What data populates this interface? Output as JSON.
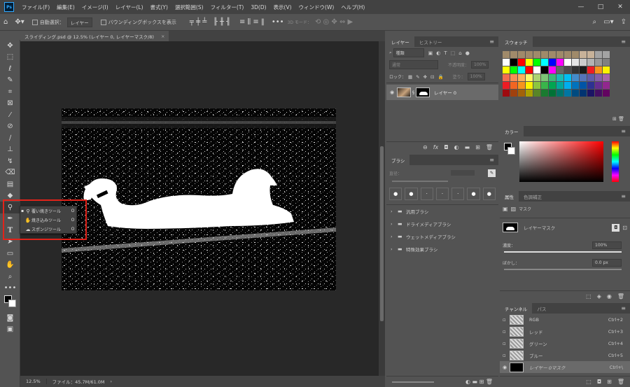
{
  "app": {
    "logo_text": "Ps"
  },
  "menu": [
    "ファイル(F)",
    "編集(E)",
    "イメージ(I)",
    "レイヤー(L)",
    "書式(Y)",
    "選択範囲(S)",
    "フィルター(T)",
    "3D(D)",
    "表示(V)",
    "ウィンドウ(W)",
    "ヘルプ(H)"
  ],
  "window_controls": [
    "—",
    "□",
    "✕"
  ],
  "options": {
    "auto_select_label": "自動選択：",
    "auto_select_value": "レイヤー",
    "bbox_label": "バウンディングボックスを表示",
    "mode_label": "3D モード："
  },
  "document": {
    "tab_title": "スライディング.psd @ 12.5% (レイヤー 0, レイヤーマスク/8)",
    "tab_close": "×",
    "zoom": "12.5%",
    "file_info": "ファイル：45.7M/61.0M"
  },
  "flyout": [
    {
      "label": "覆い焼きツール",
      "key": "O",
      "selected": true
    },
    {
      "label": "焼き込みツール",
      "key": "O",
      "selected": false
    },
    {
      "label": "スポンジツール",
      "key": "O",
      "selected": false
    }
  ],
  "layers_panel": {
    "tabs": [
      "レイヤー",
      "ヒストリー"
    ],
    "filter_kind": "種類",
    "blend_mode": "通常",
    "opacity_label": "不透明度：",
    "opacity_value": "100%",
    "lock_label": "ロック：",
    "fill_label": "塗り：",
    "fill_value": "100%",
    "layer_name": "レイヤー 0"
  },
  "brush_panel": {
    "tab": "ブラシ",
    "size_label": "直径：",
    "folders": [
      "汎用ブラシ",
      "ドライメディアブラシ",
      "ウェットメディアブラシ",
      "特殊効果ブラシ"
    ]
  },
  "swatches_panel": {
    "tab": "スウォッチ",
    "rows": [
      [
        "#a08a6a",
        "#a08a6a",
        "#a08a6a",
        "#a08a6a",
        "#a08a6a",
        "#a08a6a",
        "#a08a6a",
        "#a08a6a",
        "#a08a6a",
        "#a08a6a",
        "#c7b299",
        "#c7b299",
        "#a3a3a3",
        "#a3a3a3"
      ],
      [
        "#ffffff",
        "#000000",
        "#ff0000",
        "#ffff00",
        "#00ff00",
        "#00ffff",
        "#0000ff",
        "#ff00ff",
        "#ffffff",
        "#e6e6e6",
        "#cccccc",
        "#b3b3b3",
        "#999999",
        "#808080"
      ],
      [
        "#ffff00",
        "#00ff00",
        "#00ffff",
        "#ff0000",
        "#ffffff",
        "#000000",
        "#ff00ff",
        "#666666",
        "#4d4d4d",
        "#333333",
        "#1a1a1a",
        "#ed1c24",
        "#f7941d",
        "#fff200"
      ],
      [
        "#f26c4f",
        "#f68e56",
        "#fbaf5c",
        "#fff467",
        "#acd372",
        "#7cc576",
        "#3bb878",
        "#1abbb4",
        "#00bff3",
        "#438ccb",
        "#5574b9",
        "#605ca9",
        "#855fa8",
        "#a763a9"
      ],
      [
        "#ed1c24",
        "#f26522",
        "#f7941d",
        "#fff200",
        "#8dc63f",
        "#39b54a",
        "#00a651",
        "#00a99d",
        "#00aeef",
        "#0072bc",
        "#0054a6",
        "#2e3192",
        "#662d91",
        "#92278f"
      ],
      [
        "#9e0b0f",
        "#a0410d",
        "#a36209",
        "#aba000",
        "#598527",
        "#1a7b30",
        "#007236",
        "#00746b",
        "#0076a3",
        "#004b80",
        "#003471",
        "#1b1464",
        "#440e62",
        "#630460"
      ]
    ]
  },
  "color_panel": {
    "tab": "カラー"
  },
  "properties_panel": {
    "tabs": [
      "属性",
      "色調補正"
    ],
    "mask_label": "マスク",
    "layer_mask_label": "レイヤーマスク",
    "density_label": "濃度：",
    "density_value": "100%",
    "feather_label": "ぼかし：",
    "feather_value": "0.0 px"
  },
  "channels_panel": {
    "tabs": [
      "チャンネル",
      "パス"
    ],
    "rows": [
      {
        "name": "RGB",
        "shortcut": "Ctrl+2"
      },
      {
        "name": "レッド",
        "shortcut": "Ctrl+3"
      },
      {
        "name": "グリーン",
        "shortcut": "Ctrl+4"
      },
      {
        "name": "ブルー",
        "shortcut": "Ctrl+5"
      },
      {
        "name": "レイヤー 0マスク",
        "shortcut": "Ctrl+\\"
      }
    ]
  }
}
